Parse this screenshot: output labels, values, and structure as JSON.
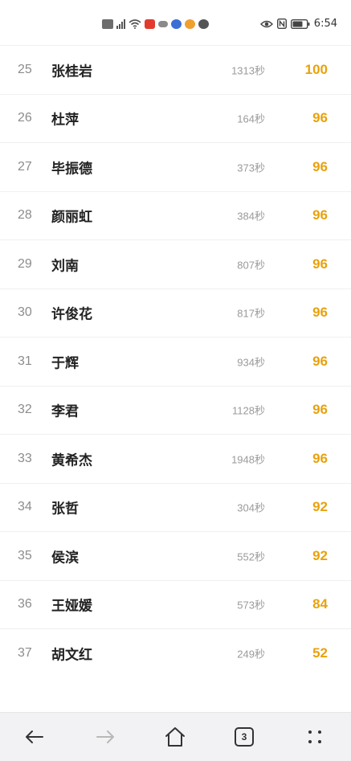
{
  "status_bar": {
    "time": "6:54",
    "network": "5G",
    "icons": [
      "hd-icon",
      "signal-icon",
      "wifi-icon",
      "app-notification-icon",
      "cloud-icon",
      "app-icon",
      "app-icon",
      "app-icon",
      "eye-icon",
      "nfc-icon",
      "battery-icon"
    ]
  },
  "rows": [
    {
      "rank": "25",
      "name": "张桂岩",
      "time": "1313秒",
      "score": "100"
    },
    {
      "rank": "26",
      "name": "杜萍",
      "time": "164秒",
      "score": "96"
    },
    {
      "rank": "27",
      "name": "毕振德",
      "time": "373秒",
      "score": "96"
    },
    {
      "rank": "28",
      "name": "颜丽虹",
      "time": "384秒",
      "score": "96"
    },
    {
      "rank": "29",
      "name": "刘南",
      "time": "807秒",
      "score": "96"
    },
    {
      "rank": "30",
      "name": "许俊花",
      "time": "817秒",
      "score": "96"
    },
    {
      "rank": "31",
      "name": "于辉",
      "time": "934秒",
      "score": "96"
    },
    {
      "rank": "32",
      "name": "李君",
      "time": "1128秒",
      "score": "96"
    },
    {
      "rank": "33",
      "name": "黄希杰",
      "time": "1948秒",
      "score": "96"
    },
    {
      "rank": "34",
      "name": "张哲",
      "time": "304秒",
      "score": "92"
    },
    {
      "rank": "35",
      "name": "侯滨",
      "time": "552秒",
      "score": "92"
    },
    {
      "rank": "36",
      "name": "王娅媛",
      "time": "573秒",
      "score": "84"
    },
    {
      "rank": "37",
      "name": "胡文红",
      "time": "249秒",
      "score": "52"
    }
  ],
  "bottom_nav": {
    "tab_count": "3",
    "buttons": [
      "back-arrow-icon",
      "forward-arrow-icon",
      "home-icon",
      "tabs-icon",
      "more-icon"
    ]
  },
  "colors": {
    "score": "#e8a20c",
    "rank": "#8c8c8c",
    "time": "#9a9a9a",
    "name": "#222222",
    "nav_bg": "#f2f2f4"
  }
}
